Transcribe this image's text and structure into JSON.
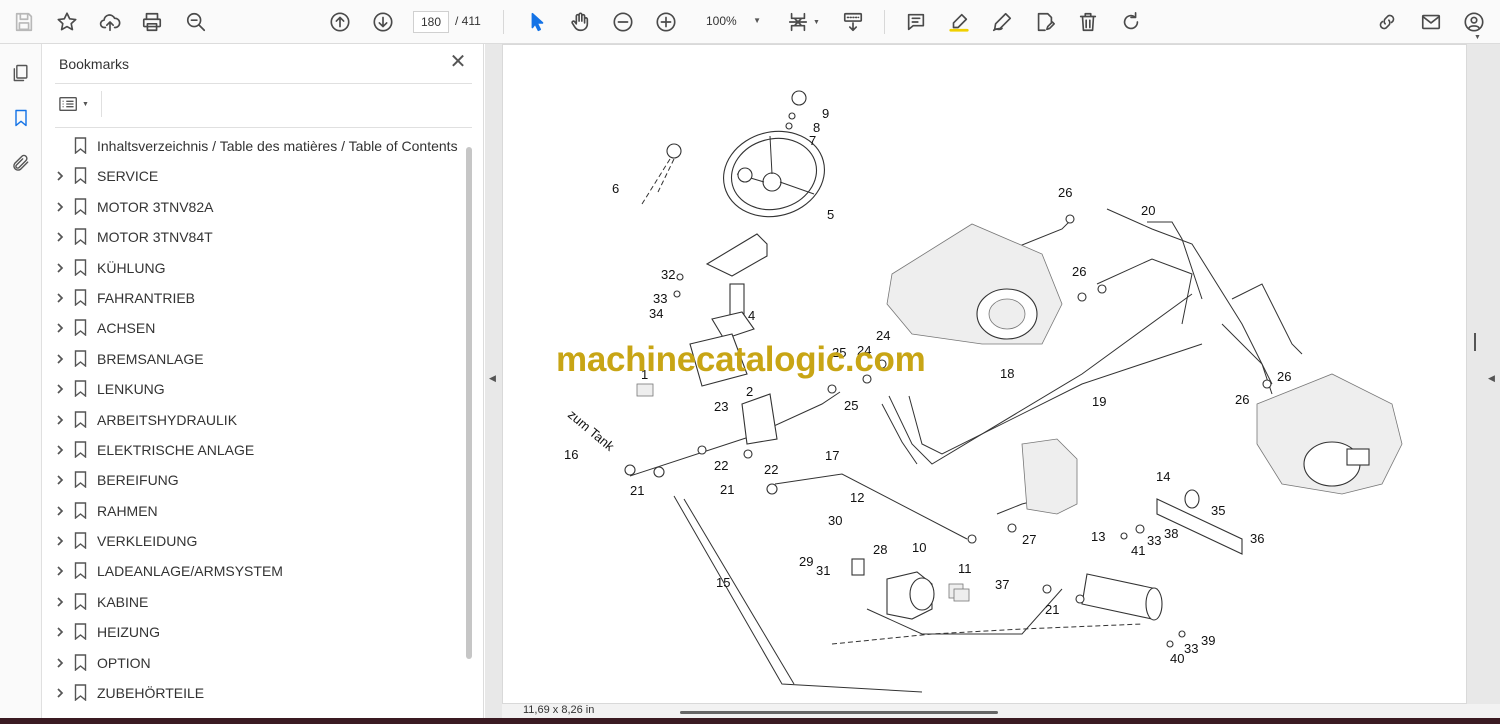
{
  "toolbar": {
    "page_current": "180",
    "page_total": "/  411",
    "zoom": "100%"
  },
  "bookmarks_panel": {
    "title": "Bookmarks",
    "items": [
      {
        "label": "Inhaltsverzeichnis / Table des matières / Table of Contents",
        "expandable": false
      },
      {
        "label": "SERVICE",
        "expandable": true
      },
      {
        "label": "MOTOR 3TNV82A",
        "expandable": true
      },
      {
        "label": "MOTOR 3TNV84T",
        "expandable": true
      },
      {
        "label": "KÜHLUNG",
        "expandable": true
      },
      {
        "label": "FAHRANTRIEB",
        "expandable": true
      },
      {
        "label": "ACHSEN",
        "expandable": true
      },
      {
        "label": "BREMSANLAGE",
        "expandable": true
      },
      {
        "label": "LENKUNG",
        "expandable": true
      },
      {
        "label": "ARBEITSHYDRAULIK",
        "expandable": true
      },
      {
        "label": "ELEKTRISCHE ANLAGE",
        "expandable": true
      },
      {
        "label": "BEREIFUNG",
        "expandable": true
      },
      {
        "label": "RAHMEN",
        "expandable": true
      },
      {
        "label": "VERKLEIDUNG",
        "expandable": true
      },
      {
        "label": "LADEANLAGE/ARMSYSTEM",
        "expandable": true
      },
      {
        "label": "KABINE",
        "expandable": true
      },
      {
        "label": "HEIZUNG",
        "expandable": true
      },
      {
        "label": "OPTION",
        "expandable": true
      },
      {
        "label": "ZUBEHÖRTEILE",
        "expandable": true
      }
    ]
  },
  "document": {
    "watermark": "machinecatalogic.com",
    "page_size": "11,69 x 8,26 in",
    "tank_note": "zum Tank",
    "part_labels": [
      "9",
      "8",
      "7",
      "6",
      "5",
      "26",
      "20",
      "26",
      "32",
      "33",
      "34",
      "4",
      "25",
      "24",
      "24",
      "1",
      "2",
      "25",
      "18",
      "19",
      "26",
      "26",
      "23",
      "22",
      "22",
      "16",
      "21",
      "21",
      "17",
      "14",
      "35",
      "36",
      "12",
      "30",
      "28",
      "10",
      "13",
      "38",
      "41",
      "33",
      "27",
      "29",
      "31",
      "11",
      "37",
      "21",
      "15",
      "39",
      "33",
      "40"
    ]
  }
}
